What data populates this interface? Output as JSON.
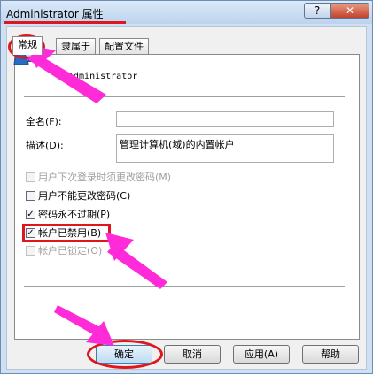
{
  "window": {
    "title": "Administrator 属性",
    "help_label": "?",
    "close_label": "✕"
  },
  "tabs": [
    {
      "label": "常规",
      "active": true
    },
    {
      "label": "隶属于",
      "active": false
    },
    {
      "label": "配置文件",
      "active": false
    }
  ],
  "general": {
    "username": "Administrator",
    "fullname_label": "全名(F):",
    "fullname_value": "",
    "description_label": "描述(D):",
    "description_value": "管理计算机(域)的内置帐户"
  },
  "options": [
    {
      "label": "用户下次登录时须更改密码(M)",
      "checked": false,
      "enabled": false
    },
    {
      "label": "用户不能更改密码(C)",
      "checked": false,
      "enabled": true
    },
    {
      "label": "密码永不过期(P)",
      "checked": true,
      "enabled": true
    },
    {
      "label": "帐户已禁用(B)",
      "checked": true,
      "enabled": true
    },
    {
      "label": "帐户已锁定(O)",
      "checked": false,
      "enabled": false
    }
  ],
  "buttons": {
    "ok": "确定",
    "cancel": "取消",
    "apply": "应用(A)",
    "help": "帮助"
  },
  "colors": {
    "annotation_red": "#e0161e",
    "annotation_magenta": "#ff2ad8",
    "window_frame": "#cfe0f3"
  }
}
